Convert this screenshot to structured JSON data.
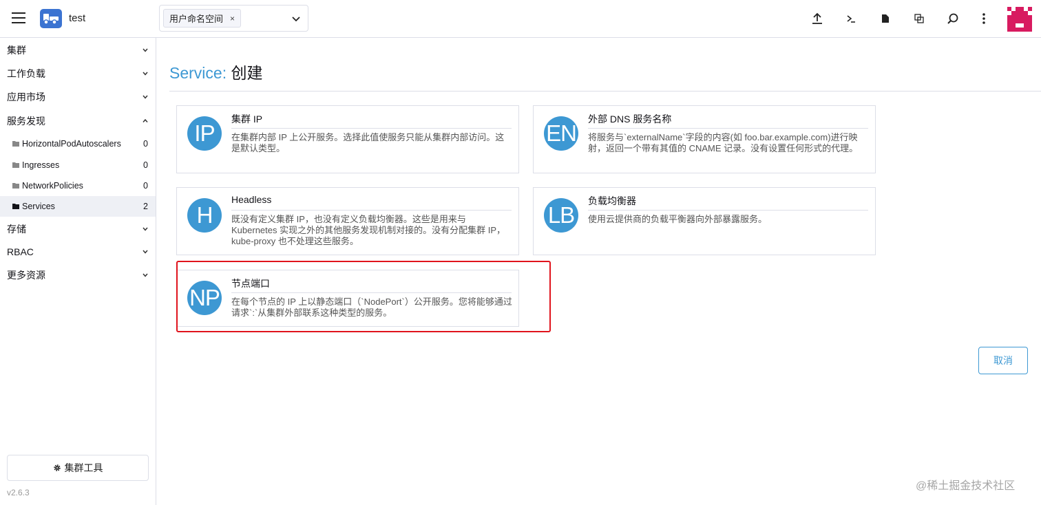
{
  "header": {
    "cluster_name": "test",
    "namespace_tag": "用户命名空间",
    "namespace_tag_close": "×"
  },
  "sidebar": {
    "groups": [
      {
        "label": "集群"
      },
      {
        "label": "工作负载"
      },
      {
        "label": "应用市场"
      },
      {
        "label": "服务发现"
      },
      {
        "label": "存储"
      },
      {
        "label": "RBAC"
      },
      {
        "label": "更多资源"
      }
    ],
    "service_discovery_items": [
      {
        "label": "HorizontalPodAutoscalers",
        "count": "0"
      },
      {
        "label": "Ingresses",
        "count": "0"
      },
      {
        "label": "NetworkPolicies",
        "count": "0"
      },
      {
        "label": "Services",
        "count": "2"
      }
    ],
    "tools_label": "集群工具",
    "version": "v2.6.3"
  },
  "page": {
    "title_resource": "Service:",
    "title_action": "创建"
  },
  "cards": [
    {
      "badge": "IP",
      "title": "集群 IP",
      "desc": "在集群内部 IP 上公开服务。选择此值使服务只能从集群内部访问。这是默认类型。"
    },
    {
      "badge": "EN",
      "title": "外部 DNS 服务名称",
      "desc": "将服务与`externalName`字段的内容(如 foo.bar.example.com)进行映射，返回一个带有其值的 CNAME 记录。没有设置任何形式的代理。"
    },
    {
      "badge": "H",
      "title": "Headless",
      "desc": "既没有定义集群 IP，也没有定义负载均衡器。这些是用来与 Kubernetes 实现之外的其他服务发现机制对接的。没有分配集群 IP，kube-proxy 也不处理这些服务。"
    },
    {
      "badge": "LB",
      "title": "负载均衡器",
      "desc": "使用云提供商的负载平衡器向外部暴露服务。"
    },
    {
      "badge": "NP",
      "title": "节点端口",
      "desc": "在每个节点的 IP 上以静态端口（`NodePort`）公开服务。您将能够通过请求`:`从集群外部联系这种类型的服务。"
    }
  ],
  "actions": {
    "cancel_label": "取消"
  },
  "watermark": "@稀土掘金技术社区",
  "colors": {
    "accent": "#3d98d3",
    "highlight": "#e0131c",
    "logo": "#3b73d1",
    "avatar": "#d81b60"
  },
  "icons": [
    "menu-icon",
    "logo-icon",
    "chevron-down-icon",
    "upload-icon",
    "terminal-icon",
    "file-icon",
    "copy-icon",
    "search-icon",
    "more-vertical-icon",
    "folder-icon",
    "gear-icon"
  ]
}
